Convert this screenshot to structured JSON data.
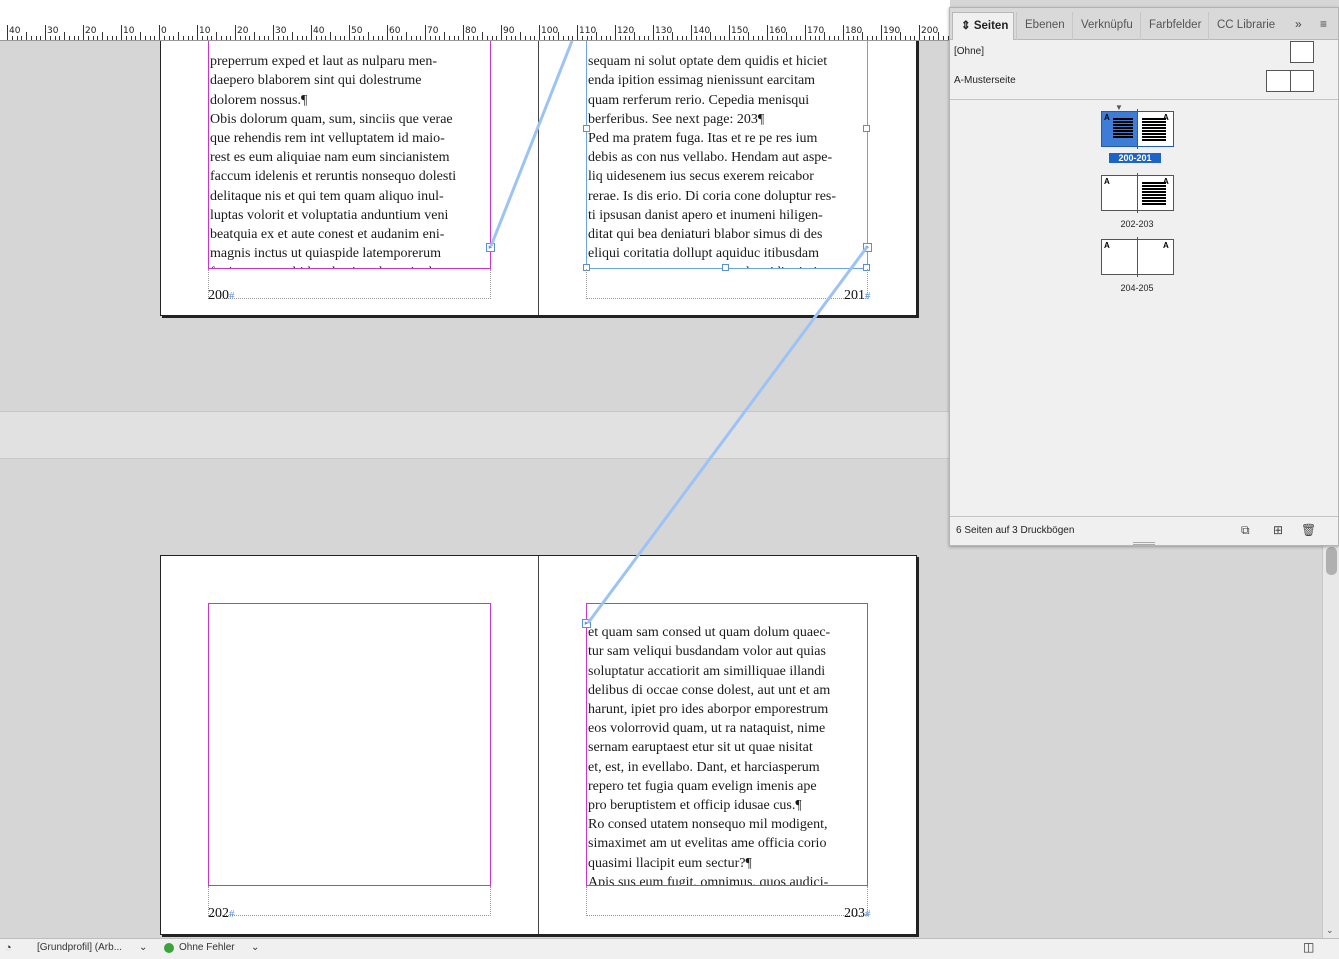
{
  "ruler": {
    "labels": [
      "40",
      "30",
      "20",
      "10",
      "0",
      "10",
      "20",
      "30",
      "40",
      "50",
      "60",
      "70",
      "80",
      "90",
      "100",
      "110",
      "120",
      "130",
      "140",
      "150",
      "160",
      "170",
      "180",
      "190",
      "200"
    ]
  },
  "spreads": [
    {
      "left_text": "preperrum exped et laut as nulparu men-\ndaepero blaborem sint qui dolestrume\ndolorem nossus.¶\nObis dolorum quam, sum, sinciis que verae\nque rehendis rem int velluptatem id maio-\nrest es eum aliquiae nam eum sincianistem\nfaccum idelenis et reruntis nonsequo dolesti\ndelitaque nis et qui tem quam aliquo inul-\nluptas volorit et voluptatia anduntium veni\nbeatquia ex et aute conest et audanim eni-\nmagnis inctus ut quiaspide latemporerum\nfugit optas apel id unda nis voluptati od ut",
      "right_text": "sequam ni solut optate dem quidis et hiciet\nenda ipition essimag nienissunt earcitam\nquam rerferum rerio. Cepedia menisqui\nberferibus. See next page: 203¶\nPed ma pratem fuga. Itas et re pe res ium\ndebis as con nus vellabo. Hendam aut aspe-\nliq uidesenem ius secus exerem reicabor\nrerae. Is dis erio. Di coria cone doluptur res-\nti ipsusan danist apero et inumeni hiligen-\nditat qui bea deniaturi blabor simus di des\neliqui coritatia dollupt aquiduc itibusdam\nquasperum, tempores accusdam idignimin",
      "left_page": "200",
      "right_page": "201"
    },
    {
      "left_text": "",
      "right_text": "et quam sam consed ut quam dolum quaec-\ntur sam veliqui busdandam volor aut quias\nsoluptatur accatiorit am similliquae illandi\ndelibus di occae conse dolest, aut unt et am\nharunt, ipiet pro ides aborpor emporestrum\neos volorrovid quam, ut ra nataquist, nime\nsernam earuptaest etur sit ut quae nisitat\net, est, in evellabo. Dant, et harciasperum\nrepero tet fugia quam evelign imenis ape\npro beruptistem et officip idusae cus.¶\nRo consed utatem nonsequo mil modigent,\nsimaximet am ut evelitas ame officia corio\nquasimi llacipit eum sectur?¶\nApis sus eum fugit, omnimus, quos audici-\num, aliaest, offictem que net qui vent.#",
      "left_page": "202",
      "right_page": "203"
    }
  ],
  "panel": {
    "tabs": [
      "Seiten",
      "Ebenen",
      "Verknüpfu",
      "Farbfelder",
      "CC Librarie"
    ],
    "masters": [
      {
        "label": "[Ohne]"
      },
      {
        "label": "A-Musterseite"
      }
    ],
    "spreads": [
      {
        "label": "200-201",
        "selected": true,
        "master_left": "A",
        "master_right": "A"
      },
      {
        "label": "202-203",
        "selected": false,
        "master_left": "A",
        "master_right": "A"
      },
      {
        "label": "204-205",
        "selected": false,
        "master_left": "A",
        "master_right": "A"
      }
    ],
    "status": "6 Seiten auf 3 Druckbögen"
  },
  "statusbar": {
    "profile": "[Grundprofil] (Arb...",
    "preflight": "Ohne Fehler",
    "preflight_color": "#3aa33a"
  },
  "colors": {
    "frame": "#c838c8",
    "thread": "#9cc3f5",
    "selection": "#1c64c8"
  }
}
